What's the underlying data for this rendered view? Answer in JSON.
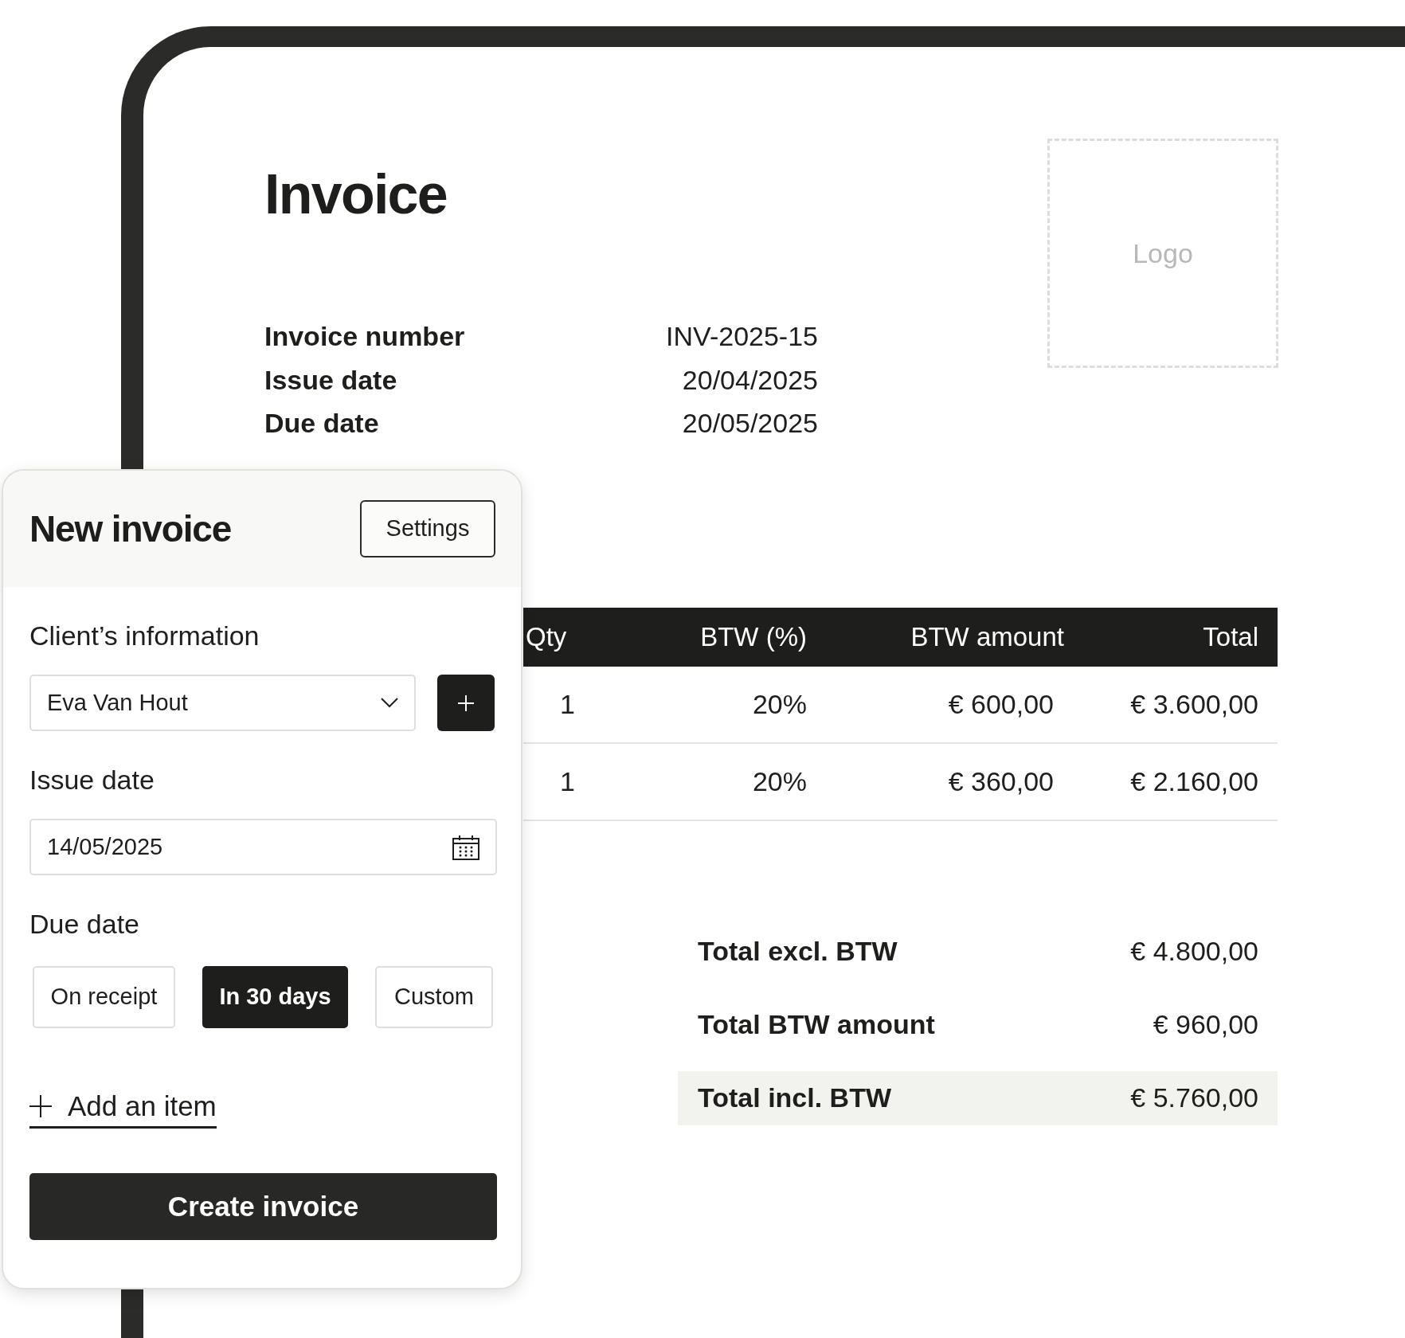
{
  "invoice": {
    "title": "Invoice",
    "logo_placeholder": "Logo",
    "details": [
      {
        "label": "Invoice number",
        "value": "INV-2025-15"
      },
      {
        "label": "Issue date",
        "value": "20/04/2025"
      },
      {
        "label": "Due date",
        "value": "20/05/2025"
      }
    ],
    "table": {
      "columns": [
        "Qty",
        "BTW (%)",
        "BTW amount",
        "Total"
      ],
      "rows": [
        [
          "1",
          "20%",
          "€ 600,00",
          "€ 3.600,00"
        ],
        [
          "1",
          "20%",
          "€ 360,00",
          "€ 2.160,00"
        ]
      ]
    },
    "totals": [
      {
        "label": "Total excl. BTW",
        "value": "€ 4.800,00",
        "highlighted": false
      },
      {
        "label": "Total BTW amount",
        "value": "€ 960,00",
        "highlighted": false
      },
      {
        "label": "Total incl. BTW",
        "value": "€ 5.760,00",
        "highlighted": true
      }
    ]
  },
  "panel": {
    "title": "New invoice",
    "settings_button": "Settings",
    "client_label": "Client’s information",
    "client_value": "Eva Van Hout",
    "issue_date_label": "Issue date",
    "issue_date_value": "14/05/2025",
    "due_date_label": "Due date",
    "due_options": [
      {
        "label": "On receipt",
        "selected": false
      },
      {
        "label": "In 30 days",
        "selected": true
      },
      {
        "label": "Custom",
        "selected": false
      }
    ],
    "add_item": "Add an item",
    "create_button": "Create invoice"
  }
}
